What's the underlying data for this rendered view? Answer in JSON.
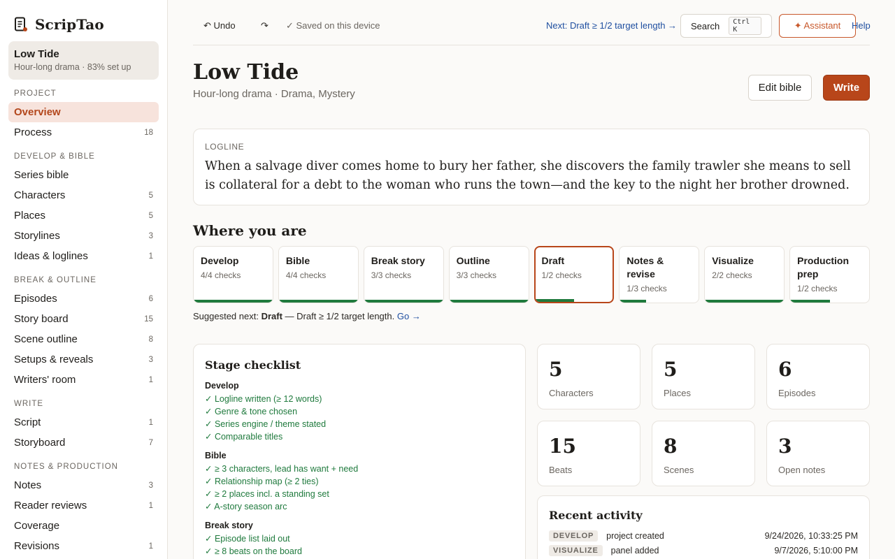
{
  "app": {
    "name": "ScripTao"
  },
  "project": {
    "name": "Low Tide",
    "meta": "Hour-long drama · 83% set up"
  },
  "nav": {
    "sections": [
      {
        "label": "PROJECT",
        "items": [
          {
            "label": "Overview",
            "count": "",
            "active": true
          },
          {
            "label": "Process",
            "count": "18"
          }
        ]
      },
      {
        "label": "DEVELOP & BIBLE",
        "items": [
          {
            "label": "Series bible",
            "count": ""
          },
          {
            "label": "Characters",
            "count": "5"
          },
          {
            "label": "Places",
            "count": "5"
          },
          {
            "label": "Storylines",
            "count": "3"
          },
          {
            "label": "Ideas & loglines",
            "count": "1"
          }
        ]
      },
      {
        "label": "BREAK & OUTLINE",
        "items": [
          {
            "label": "Episodes",
            "count": "6"
          },
          {
            "label": "Story board",
            "count": "15"
          },
          {
            "label": "Scene outline",
            "count": "8"
          },
          {
            "label": "Setups & reveals",
            "count": "3"
          },
          {
            "label": "Writers' room",
            "count": "1"
          }
        ]
      },
      {
        "label": "WRITE",
        "items": [
          {
            "label": "Script",
            "count": "1"
          },
          {
            "label": "Storyboard",
            "count": "7"
          }
        ]
      },
      {
        "label": "NOTES & PRODUCTION",
        "items": [
          {
            "label": "Notes",
            "count": "3"
          },
          {
            "label": "Reader reviews",
            "count": "1"
          },
          {
            "label": "Coverage",
            "count": ""
          },
          {
            "label": "Revisions",
            "count": "1"
          }
        ]
      }
    ]
  },
  "topbar": {
    "undo": "↶ Undo",
    "redo": "↷",
    "saved": "✓ Saved on this device",
    "next": "Next: Draft ≥ 1/2 target length →",
    "search": "Search",
    "search_kbd": "Ctrl K",
    "assistant": "✦ Assistant",
    "help": "Help"
  },
  "header": {
    "title": "Low Tide",
    "subtitle": "Hour-long drama · Drama, Mystery",
    "edit_bible": "Edit bible",
    "write": "Write"
  },
  "logline": {
    "label": "LOGLINE",
    "text": "When a salvage diver comes home to bury her father, she discovers the family trawler she means to sell is collateral for a debt to the woman who runs the town—and the key to the night her brother drowned."
  },
  "where": {
    "heading": "Where you are",
    "stages": [
      {
        "name": "Develop",
        "checks": "4/4 checks",
        "progress": 1.0
      },
      {
        "name": "Bible",
        "checks": "4/4 checks",
        "progress": 1.0
      },
      {
        "name": "Break story",
        "checks": "3/3 checks",
        "progress": 1.0
      },
      {
        "name": "Outline",
        "checks": "3/3 checks",
        "progress": 1.0
      },
      {
        "name": "Draft",
        "checks": "1/2 checks",
        "progress": 0.5,
        "current": true
      },
      {
        "name": "Notes & revise",
        "checks": "1/3 checks",
        "progress": 0.333
      },
      {
        "name": "Visualize",
        "checks": "2/2 checks",
        "progress": 1.0
      },
      {
        "name": "Production prep",
        "checks": "1/2 checks",
        "progress": 0.5
      }
    ],
    "suggest_prefix": "Suggested next: ",
    "suggest_stage": "Draft",
    "suggest_rest": " — Draft ≥ 1/2 target length. ",
    "suggest_go": "Go →"
  },
  "checklist": {
    "title": "Stage checklist",
    "groups": [
      {
        "name": "Develop",
        "items": [
          "✓ Logline written (≥ 12 words)",
          "✓ Genre & tone chosen",
          "✓ Series engine / theme stated",
          "✓ Comparable titles"
        ]
      },
      {
        "name": "Bible",
        "items": [
          "✓ ≥ 3 characters, lead has want + need",
          "✓ Relationship map (≥ 2 ties)",
          "✓ ≥ 2 places incl. a standing set",
          "✓ A-story season arc"
        ]
      },
      {
        "name": "Break story",
        "items": [
          "✓ Episode list laid out",
          "✓ ≥ 8 beats on the board"
        ]
      }
    ]
  },
  "stats": [
    {
      "num": "5",
      "label": "Characters"
    },
    {
      "num": "5",
      "label": "Places"
    },
    {
      "num": "6",
      "label": "Episodes"
    },
    {
      "num": "15",
      "label": "Beats"
    },
    {
      "num": "8",
      "label": "Scenes"
    },
    {
      "num": "3",
      "label": "Open notes"
    }
  ],
  "activity": {
    "title": "Recent activity",
    "rows": [
      {
        "badge": "DEVELOP",
        "what": "project created",
        "when": "9/24/2026, 10:33:25 PM"
      },
      {
        "badge": "VISUALIZE",
        "what": "panel added",
        "when": "9/7/2026, 5:10:00 PM"
      }
    ]
  },
  "colors": {
    "accent": "#b8461a",
    "success": "#1f7a3d",
    "link": "#1f4fa0"
  }
}
